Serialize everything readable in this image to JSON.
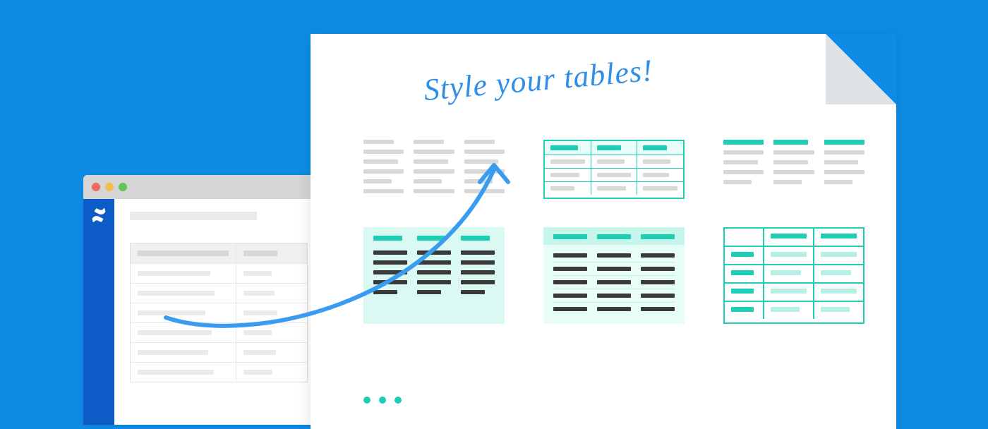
{
  "headline": "Style your tables!",
  "browser": {
    "traffic_lights": [
      "red",
      "yellow",
      "green"
    ],
    "sidebar_icon": "confluence-icon"
  },
  "colors": {
    "bg": "#0d8ce6",
    "teal": "#1eceb4",
    "mint": "#d9f9f2",
    "gray": "#d8d8d8",
    "dark": "#3a3a3a"
  },
  "ellipsis_dots": 3,
  "table_samples": [
    "plain-gray",
    "teal-bordered",
    "teal-header-only",
    "mint-three-column",
    "mint-striped",
    "teal-grid"
  ]
}
